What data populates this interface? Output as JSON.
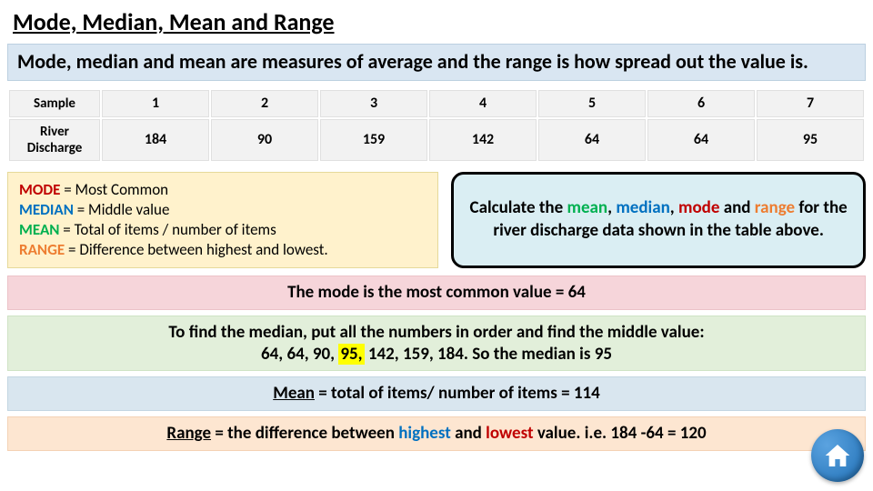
{
  "title": "Mode, Median, Mean and Range",
  "intro": "Mode, median and mean are measures of average and the range is how spread out the value is.",
  "table": {
    "header_label": "Sample",
    "row_label": "River Discharge",
    "samples": [
      "1",
      "2",
      "3",
      "4",
      "5",
      "6",
      "7"
    ],
    "values": [
      "184",
      "90",
      "159",
      "142",
      "64",
      "64",
      "95"
    ]
  },
  "defs": {
    "mode": {
      "term": "MODE",
      "text": " = Most Common"
    },
    "median": {
      "term": "MEDIAN",
      "text": " = Middle value"
    },
    "mean": {
      "term": "MEAN",
      "text": " = Total of items / number of items"
    },
    "range": {
      "term": "RANGE",
      "text": " = Difference between highest and lowest."
    }
  },
  "callout": {
    "pre": "Calculate the ",
    "w_mean": "mean",
    "w_median": "median",
    "w_mode": "mode",
    "w_range": "range",
    "post": " for the river discharge data shown in the table above."
  },
  "band_mode": "The mode is the most common value = 64",
  "band_median": {
    "line1": "To find the median, put all the numbers in order and find the middle value:",
    "seq_a": "64, 64, 90, ",
    "seq_hl": "95,",
    "seq_b": " 142, 159, 184. So the median is 95"
  },
  "band_mean": {
    "label": "Mean",
    "text": " = total of items/ number of items = 114"
  },
  "band_range": {
    "label": "Range",
    "pre": " = the difference between ",
    "hi": "highest",
    "mid": " and ",
    "lo": "lowest",
    "post": " value. i.e. 184 -64 = 120"
  },
  "home_icon_name": "home-icon"
}
